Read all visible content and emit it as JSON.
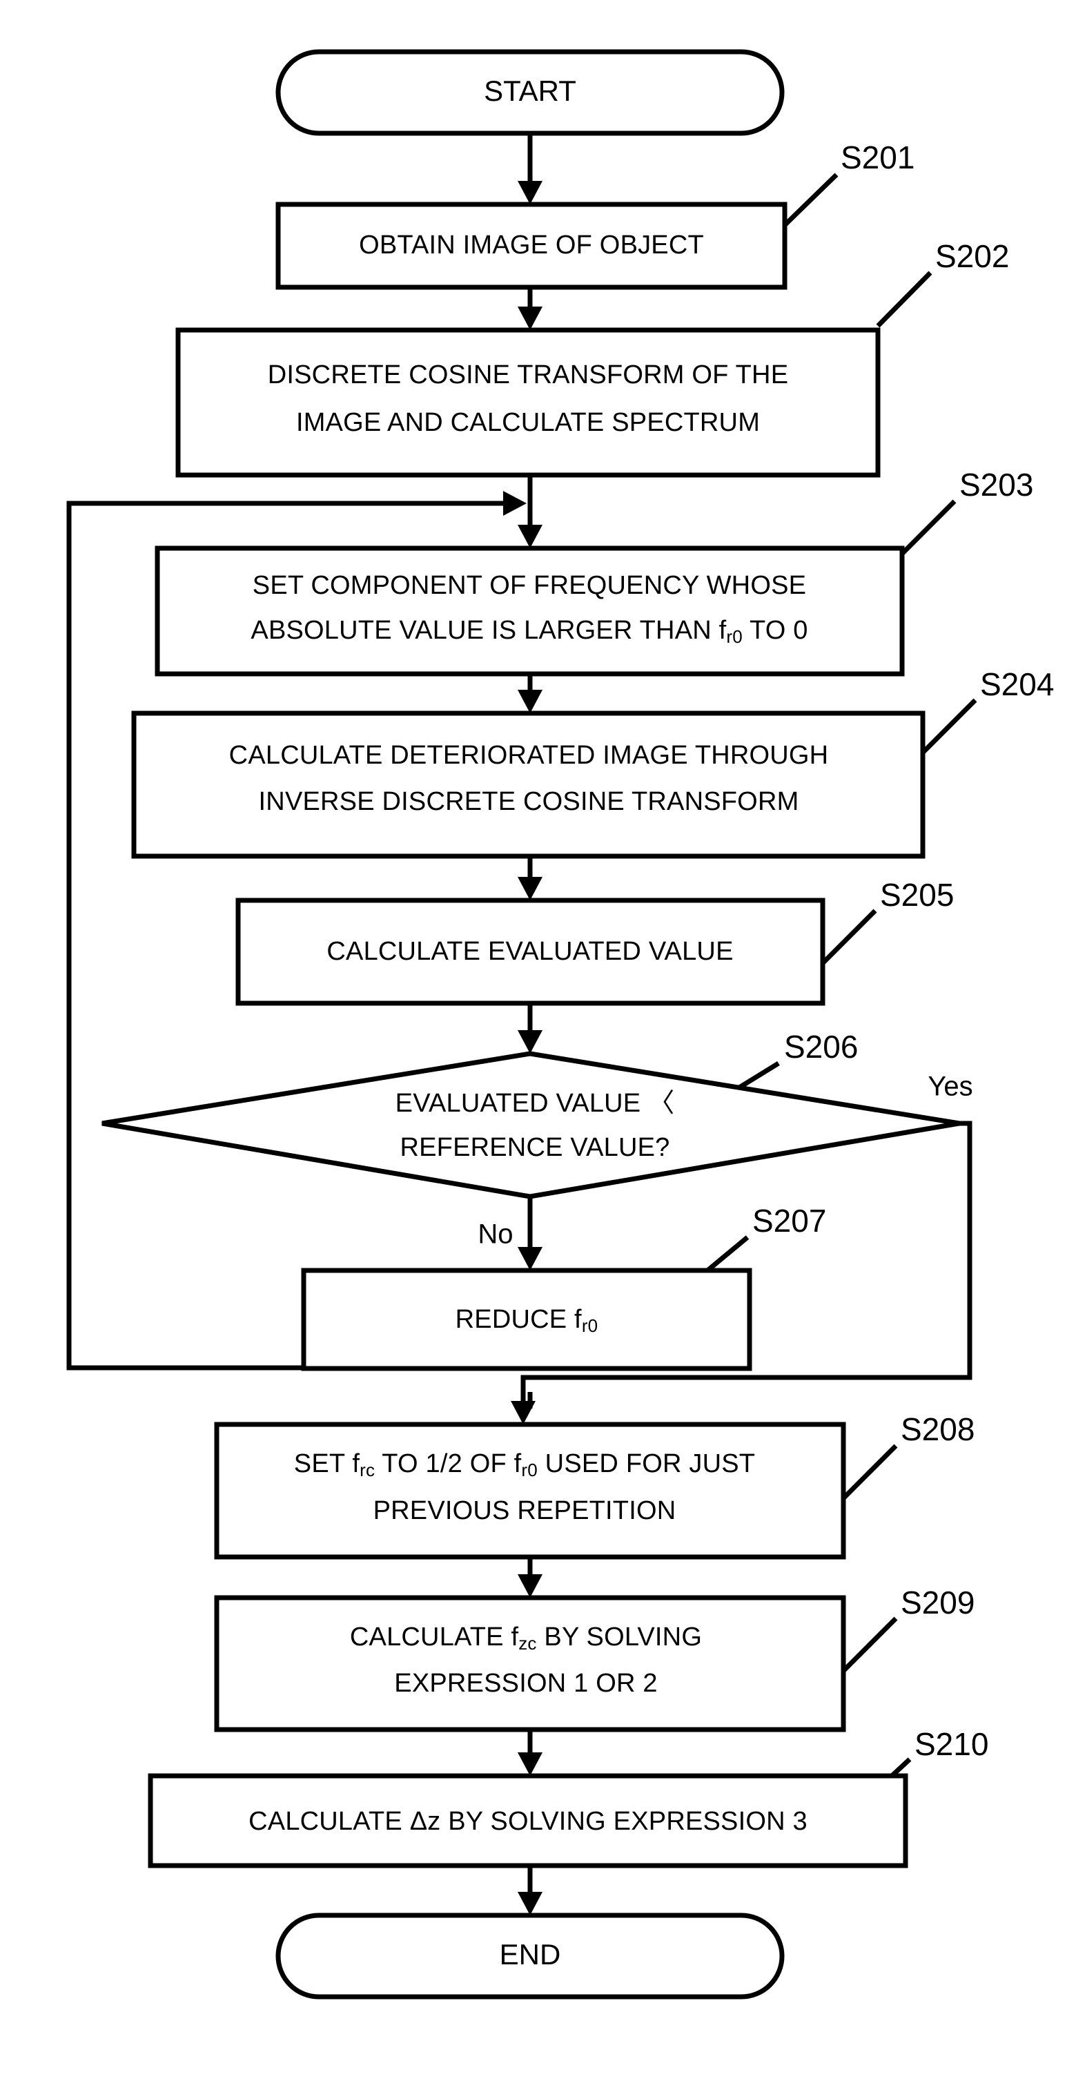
{
  "diagram": {
    "type": "flowchart",
    "title": "",
    "orientation": "top-to-bottom",
    "nodes": [
      {
        "id": "start",
        "shape": "terminator",
        "label": "START"
      },
      {
        "id": "s201",
        "shape": "process",
        "step": "S201",
        "lines": [
          "OBTAIN IMAGE OF OBJECT"
        ]
      },
      {
        "id": "s202",
        "shape": "process",
        "step": "S202",
        "lines": [
          "DISCRETE COSINE TRANSFORM OF THE",
          "IMAGE AND CALCULATE SPECTRUM"
        ]
      },
      {
        "id": "s203",
        "shape": "process",
        "step": "S203",
        "line1": "SET COMPONENT OF FREQUENCY WHOSE",
        "line2_a": "ABSOLUTE VALUE IS LARGER THAN f",
        "line2_sub": "r0",
        "line2_b": " TO 0"
      },
      {
        "id": "s204",
        "shape": "process",
        "step": "S204",
        "lines": [
          "CALCULATE DETERIORATED IMAGE THROUGH",
          "INVERSE DISCRETE COSINE TRANSFORM"
        ]
      },
      {
        "id": "s205",
        "shape": "process",
        "step": "S205",
        "lines": [
          "CALCULATE EVALUATED VALUE"
        ]
      },
      {
        "id": "s206",
        "shape": "decision",
        "step": "S206",
        "lines": [
          "EVALUATED VALUE 〈",
          "REFERENCE VALUE?"
        ],
        "branch_yes": "Yes",
        "branch_no": "No"
      },
      {
        "id": "s207",
        "shape": "process",
        "step": "S207",
        "line1_a": "REDUCE f",
        "line1_sub": "r0"
      },
      {
        "id": "s208",
        "shape": "process",
        "step": "S208",
        "line1_a": "SET f",
        "line1_sub1": "rc",
        "line1_b": " TO 1/2 OF f",
        "line1_sub2": "r0",
        "line1_c": " USED FOR JUST",
        "line2": "PREVIOUS REPETITION"
      },
      {
        "id": "s209",
        "shape": "process",
        "step": "S209",
        "line1_a": "CALCULATE f",
        "line1_sub": "zc",
        "line1_b": " BY SOLVING",
        "line2": "EXPRESSION 1 OR 2"
      },
      {
        "id": "s210",
        "shape": "process",
        "step": "S210",
        "lines": [
          "CALCULATE  Δz BY SOLVING EXPRESSION 3"
        ]
      },
      {
        "id": "end",
        "shape": "terminator",
        "label": "END"
      }
    ],
    "edges": [
      {
        "from": "start",
        "to": "s201",
        "label": ""
      },
      {
        "from": "s201",
        "to": "s202",
        "label": ""
      },
      {
        "from": "s202",
        "to": "s203",
        "label": ""
      },
      {
        "from": "s203",
        "to": "s204",
        "label": ""
      },
      {
        "from": "s204",
        "to": "s205",
        "label": ""
      },
      {
        "from": "s205",
        "to": "s206",
        "label": ""
      },
      {
        "from": "s206",
        "to": "s207",
        "label": "No"
      },
      {
        "from": "s206",
        "to": "s208",
        "label": "Yes"
      },
      {
        "from": "s207",
        "to": "s203",
        "label": ""
      },
      {
        "from": "s208",
        "to": "s209",
        "label": ""
      },
      {
        "from": "s209",
        "to": "s210",
        "label": ""
      },
      {
        "from": "s210",
        "to": "end",
        "label": ""
      }
    ],
    "colors": {
      "stroke": "#000000",
      "fill": "#ffffff",
      "text": "#000000"
    }
  }
}
